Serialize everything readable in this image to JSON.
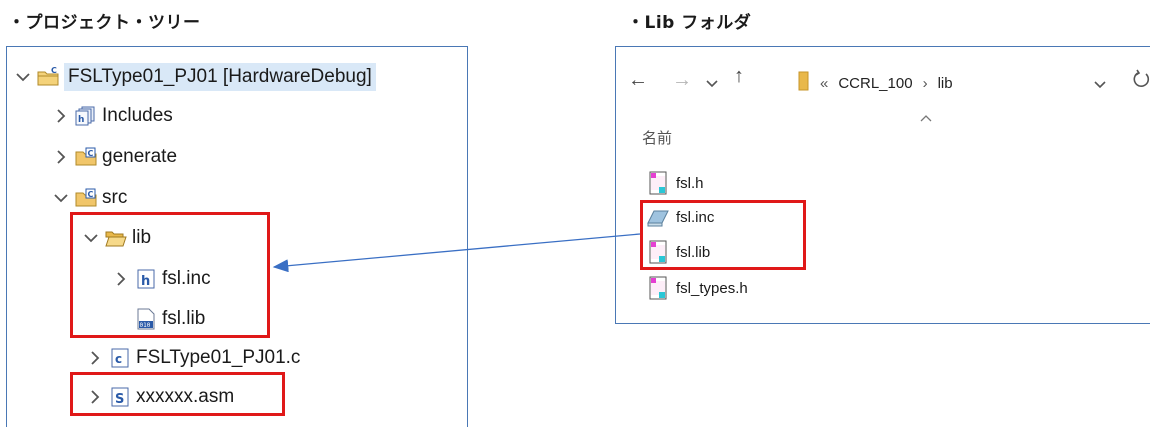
{
  "captions": {
    "left": "・プロジェクト・ツリー",
    "right": "・Lib フォルダ"
  },
  "tree": {
    "project": "FSLType01_PJ01 [HardwareDebug]",
    "items": [
      {
        "label": "Includes"
      },
      {
        "label": "generate"
      },
      {
        "label": "src"
      },
      {
        "label": "lib"
      },
      {
        "label": "fsl.inc"
      },
      {
        "label": "fsl.lib"
      },
      {
        "label": "FSLType01_PJ01.c"
      },
      {
        "label": "xxxxxx.asm"
      }
    ]
  },
  "explorer": {
    "breadcrumb": {
      "overflow": "«",
      "folder": "CCRL_100",
      "separator": "›",
      "current": "lib"
    },
    "column_header": "名前",
    "files": [
      {
        "name": "fsl.h",
        "icon": "header-file-icon"
      },
      {
        "name": "fsl.inc",
        "icon": "inc-file-icon"
      },
      {
        "name": "fsl.lib",
        "icon": "lib-file-icon"
      },
      {
        "name": "fsl_types.h",
        "icon": "header-file-icon"
      }
    ]
  },
  "colors": {
    "highlight": "#e01818",
    "panel_border": "#4a78b5",
    "arrow": "#3a6fc4",
    "selection": "#d9e8f7",
    "folder": "#e9b84a"
  }
}
